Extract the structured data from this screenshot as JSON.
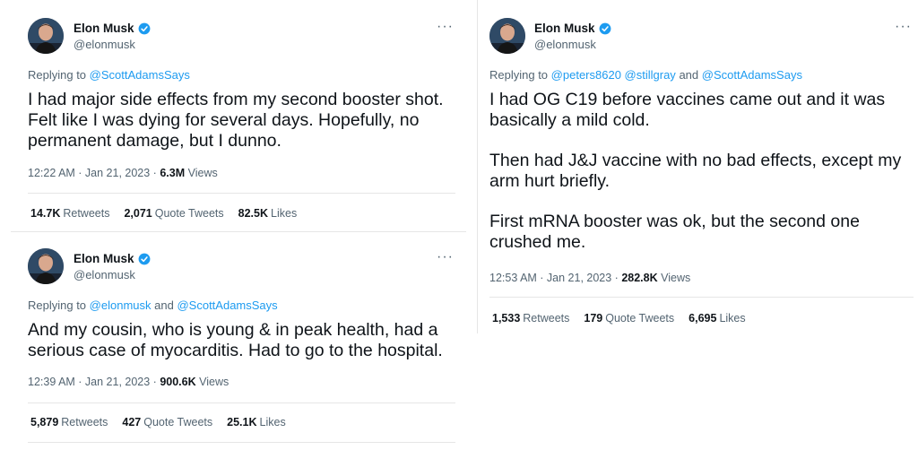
{
  "tweets": [
    {
      "name": "Elon Musk",
      "handle": "@elonmusk",
      "replying_prefix": "Replying to",
      "replying_to": [
        "@ScottAdamsSays"
      ],
      "replying_joiner": "",
      "body": [
        "I had major side effects from my second booster shot. Felt like I was dying for several days. Hopefully, no permanent damage, but I dunno."
      ],
      "time": "12:22 AM · Jan 21, 2023 · ",
      "views": "6.3M",
      "views_label": "Views",
      "retweets": "14.7K",
      "retweets_label": "Retweets",
      "quotes": "2,071",
      "quotes_label": "Quote Tweets",
      "likes": "82.5K",
      "likes_label": "Likes"
    },
    {
      "name": "Elon Musk",
      "handle": "@elonmusk",
      "replying_prefix": "Replying to",
      "replying_to": [
        "@elonmusk",
        "@ScottAdamsSays"
      ],
      "replying_joiner": "and",
      "body": [
        "And my cousin, who is young & in peak health, had a serious case of myocarditis. Had to go to the hospital."
      ],
      "time": "12:39 AM · Jan 21, 2023 · ",
      "views": "900.6K",
      "views_label": "Views",
      "retweets": "5,879",
      "retweets_label": "Retweets",
      "quotes": "427",
      "quotes_label": "Quote Tweets",
      "likes": "25.1K",
      "likes_label": "Likes"
    },
    {
      "name": "Elon Musk",
      "handle": "@elonmusk",
      "replying_prefix": "Replying to",
      "replying_to": [
        "@peters8620",
        "@stillgray",
        "@ScottAdamsSays"
      ],
      "replying_joiner": "and",
      "body": [
        "I had OG C19 before vaccines came out and it was basically a mild cold.",
        "Then had J&J vaccine with no bad effects, except my arm hurt briefly.",
        "First mRNA booster was ok, but the second one crushed me."
      ],
      "time": "12:53 AM · Jan 21, 2023 · ",
      "views": "282.8K",
      "views_label": "Views",
      "retweets": "1,533",
      "retweets_label": "Retweets",
      "quotes": "179",
      "quotes_label": "Quote Tweets",
      "likes": "6,695",
      "likes_label": "Likes"
    }
  ],
  "more_icon": "more-horizontal-icon",
  "verified_icon": "verified-badge-icon",
  "colors": {
    "link": "#1d9bf0",
    "muted": "#536471",
    "text": "#0f1419",
    "divider": "#e6e6e6"
  }
}
